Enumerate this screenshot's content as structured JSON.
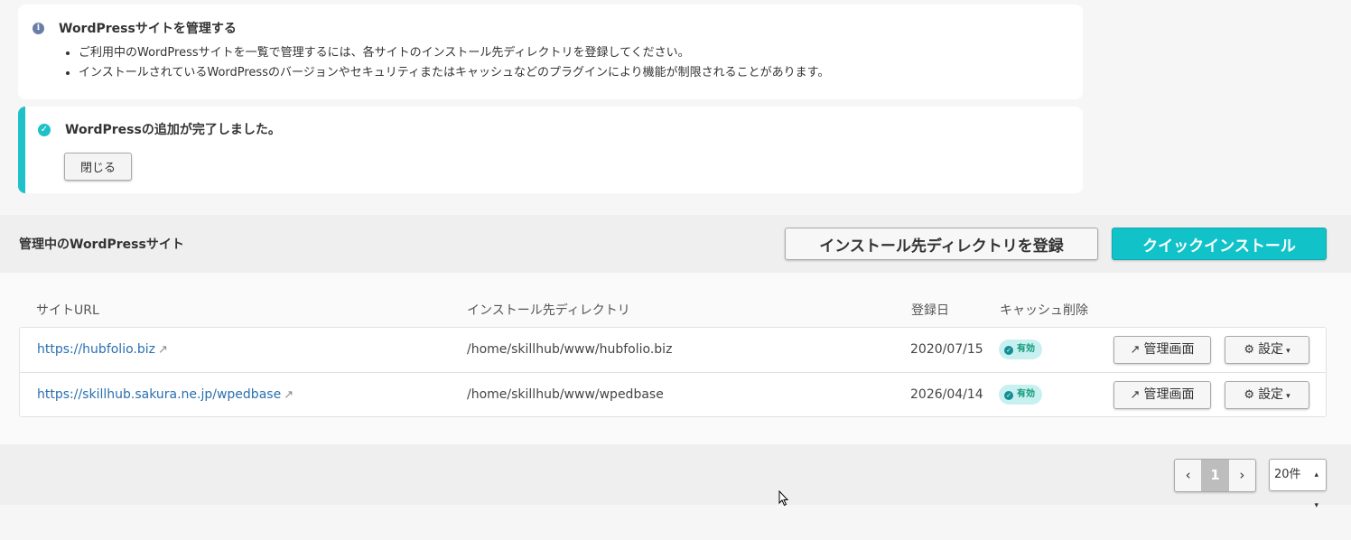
{
  "info": {
    "title": "WordPressサイトを管理する",
    "items": [
      "ご利用中のWordPressサイトを一覧で管理するには、各サイトのインストール先ディレクトリを登録してください。",
      "インストールされているWordPressのバージョンやセキュリティまたはキャッシュなどのプラグインにより機能が制限されることがあります。"
    ]
  },
  "notice": {
    "message": "WordPressの追加が完了しました。",
    "close_label": "閉じる"
  },
  "section": {
    "title": "管理中のWordPressサイト",
    "register_label": "インストール先ディレクトリを登録",
    "quick_install_label": "クイックインストール"
  },
  "table": {
    "headers": [
      "サイトURL",
      "インストール先ディレクトリ",
      "登録日",
      "キャッシュ削除"
    ],
    "rows": [
      {
        "url": "https://hubfolio.biz",
        "dir": "/home/skillhub/www/hubfolio.biz",
        "date": "2020/07/15",
        "cache": "有効",
        "admin_label": "管理画面",
        "settings_label": "設定"
      },
      {
        "url": "https://skillhub.sakura.ne.jp/wpedbase",
        "dir": "/home/skillhub/www/wpedbase",
        "date": "2026/04/14",
        "cache": "有効",
        "admin_label": "管理画面",
        "settings_label": "設定"
      }
    ]
  },
  "pagination": {
    "current_page": "1",
    "per_page": "20件"
  },
  "colors": {
    "accent": "#11c3c9",
    "link": "#2a6fb0"
  }
}
